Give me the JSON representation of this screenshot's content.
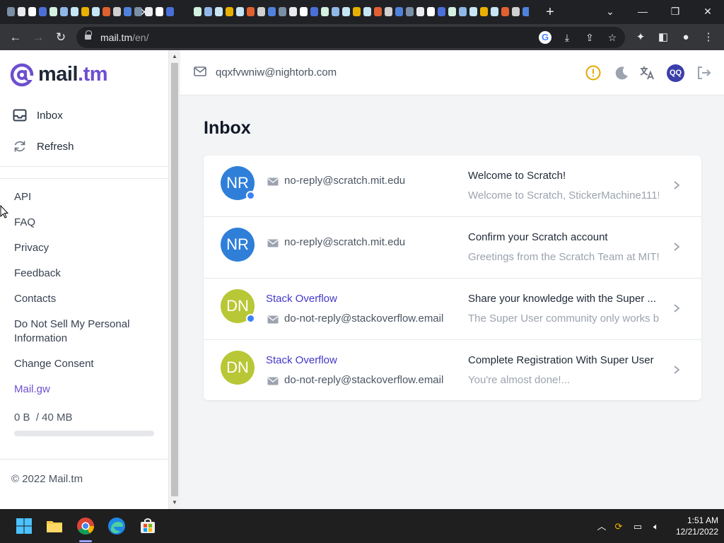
{
  "browser": {
    "url_host": "mail.tm",
    "url_path": "/en/",
    "tab_icon_colors": [
      "#7a8fa6",
      "#e8eaed",
      "#ffffff",
      "#4a6fd8",
      "#d4f0e0",
      "#8fb7e8",
      "#c7e6f5",
      "#e8b000",
      "#c7e6f5",
      "#e06030",
      "#d0d0d0",
      "#4f82dc"
    ]
  },
  "sidebar": {
    "logo_prefix": "mail",
    "logo_suffix": ".tm",
    "nav": [
      {
        "label": "Inbox",
        "icon": "inbox-icon"
      },
      {
        "label": "Refresh",
        "icon": "refresh-icon"
      }
    ],
    "links": [
      "API",
      "FAQ",
      "Privacy",
      "Feedback",
      "Contacts",
      "Do Not Sell My Personal Information",
      "Change Consent",
      "Mail.gw"
    ],
    "quota_text": "0 B  / 40 MB",
    "quota_used_fraction": 0,
    "copyright": "© 2022 Mail.tm"
  },
  "header": {
    "account_email": "qqxfvwniw@nightorb.com",
    "avatar_initials": "QQ"
  },
  "main": {
    "title": "Inbox",
    "messages": [
      {
        "initials": "NR",
        "avatar_color": "#2f7fd9",
        "unread": true,
        "sender_name": "",
        "sender_email": "no-reply@scratch.mit.edu",
        "subject": "Welcome to Scratch!",
        "preview": "Welcome to Scratch, StickerMachine111!"
      },
      {
        "initials": "NR",
        "avatar_color": "#2f7fd9",
        "unread": false,
        "sender_name": "",
        "sender_email": "no-reply@scratch.mit.edu",
        "subject": "Confirm your Scratch account",
        "preview": "Greetings from the Scratch Team at MIT!"
      },
      {
        "initials": "DN",
        "avatar_color": "#b8c735",
        "unread": true,
        "sender_name": "Stack Overflow",
        "sender_email": "do-not-reply@stackoverflow.email",
        "subject": "Share your knowledge with the Super ...",
        "preview": "The Super User community only works be"
      },
      {
        "initials": "DN",
        "avatar_color": "#b8c735",
        "unread": false,
        "sender_name": "Stack Overflow",
        "sender_email": "do-not-reply@stackoverflow.email",
        "subject": "Complete Registration With Super User",
        "preview": "You're almost done!..."
      }
    ]
  },
  "taskbar": {
    "time": "1:51 AM",
    "date": "12/21/2022"
  },
  "colors": {
    "accent": "#6d4fd0",
    "unread_dot": "#3b82f6",
    "warning": "#e6a700"
  }
}
